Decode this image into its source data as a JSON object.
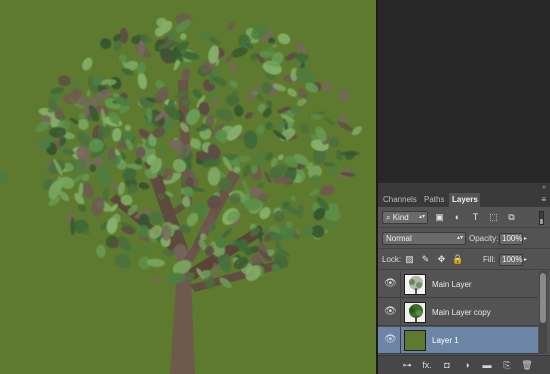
{
  "panel": {
    "tabs": [
      "Channels",
      "Paths",
      "Layers"
    ],
    "active_tab": "Layers",
    "collapse_glyph": "»",
    "menu_glyph": "≡",
    "filter": {
      "kind_label": "Kind",
      "kind_search_glyph": "⌕",
      "select_arrows": "▴▾",
      "icons": [
        {
          "name": "pixel-filter-icon",
          "glyph": "▣"
        },
        {
          "name": "adjustment-filter-icon",
          "glyph": "◐"
        },
        {
          "name": "type-filter-icon",
          "glyph": "T"
        },
        {
          "name": "shape-filter-icon",
          "glyph": "⬚"
        },
        {
          "name": "smart-object-filter-icon",
          "glyph": "⧉"
        }
      ]
    },
    "blend_mode": "Normal",
    "opacity_label": "Opacity:",
    "opacity_value": "100%",
    "lock_label": "Lock:",
    "lock_icons": [
      {
        "name": "lock-transparent-pixels-icon",
        "glyph": "▨"
      },
      {
        "name": "lock-image-pixels-icon",
        "glyph": "✎"
      },
      {
        "name": "lock-position-icon",
        "glyph": "✥"
      },
      {
        "name": "lock-all-icon",
        "glyph": "🔒"
      }
    ],
    "fill_label": "Fill:",
    "fill_value": "100%",
    "eye_glyph": "👁",
    "layers": [
      {
        "name": "Main Layer",
        "visible": true,
        "selected": false
      },
      {
        "name": "Main Layer copy",
        "visible": true,
        "selected": false
      },
      {
        "name": "Layer 1",
        "visible": true,
        "selected": true
      }
    ],
    "footer_icons": [
      {
        "name": "link-layers-icon",
        "glyph": "⊶"
      },
      {
        "name": "fx-icon",
        "glyph": "fx."
      },
      {
        "name": "add-mask-icon",
        "glyph": "◘"
      },
      {
        "name": "adjustment-layer-icon",
        "glyph": "◑"
      },
      {
        "name": "new-group-icon",
        "glyph": "▬"
      },
      {
        "name": "new-layer-icon",
        "glyph": "⎘"
      },
      {
        "name": "delete-layer-icon",
        "glyph": "🗑"
      }
    ]
  },
  "colors": {
    "canvas_background": "#5e7a2e",
    "panel_background": "#535353",
    "selected_layer": "#6c84a6"
  }
}
